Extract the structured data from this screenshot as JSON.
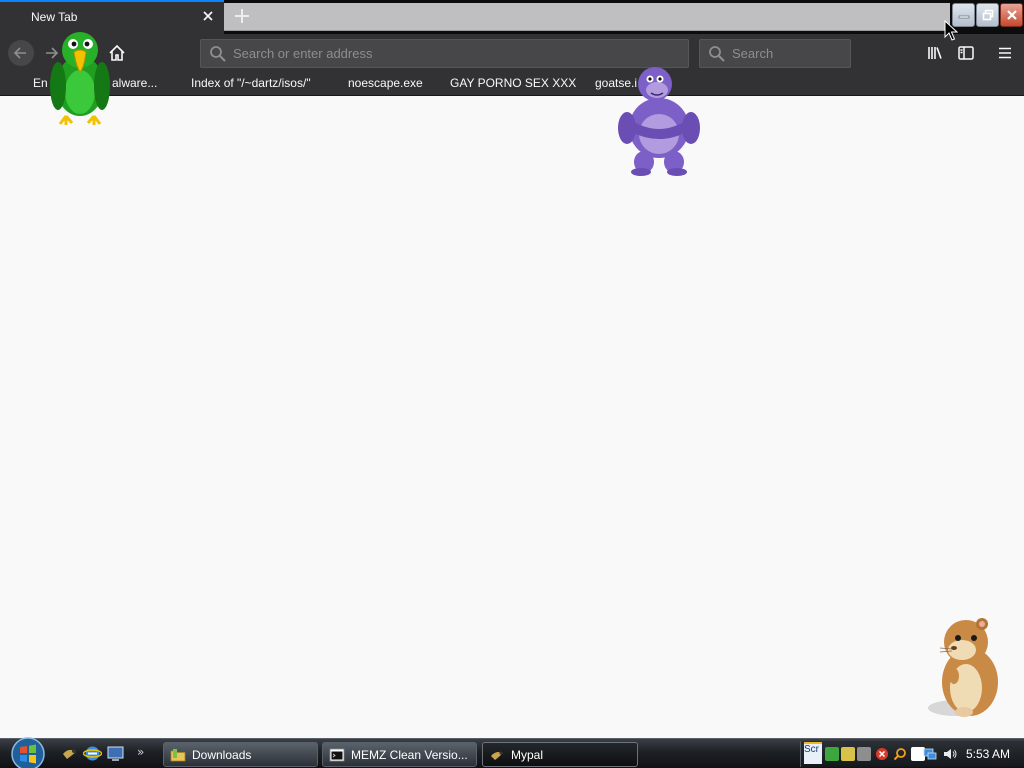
{
  "browser": {
    "tab": {
      "title": "New Tab"
    },
    "address_bar": {
      "placeholder": "Search or enter address"
    },
    "search_bar": {
      "placeholder": "Search"
    }
  },
  "bookmarks": [
    {
      "label": "En"
    },
    {
      "label": "alware..."
    },
    {
      "label": "Index of \"/~dartz/isos/\""
    },
    {
      "label": "noescape.exe"
    },
    {
      "label": "GAY PORNO SEX XXX"
    },
    {
      "label": "goatse.i"
    }
  ],
  "taskbar": {
    "buttons": [
      {
        "label": "Downloads",
        "icon": "folder-icon"
      },
      {
        "label": "MEMZ Clean Versio...",
        "icon": "console-icon"
      },
      {
        "label": "Mypal",
        "icon": "mypal-icon"
      }
    ],
    "tray_partial_text": "Scr",
    "clock": "5:53 AM"
  },
  "colors": {
    "chrome_dark": "#323234",
    "tab_strip": "#0c0c0d",
    "accent": "#0a84ff",
    "page_bg": "#f9f9fa"
  },
  "overlays": [
    "green-parrot-sprite",
    "purple-gorilla-sprite",
    "hamster-sprite"
  ]
}
